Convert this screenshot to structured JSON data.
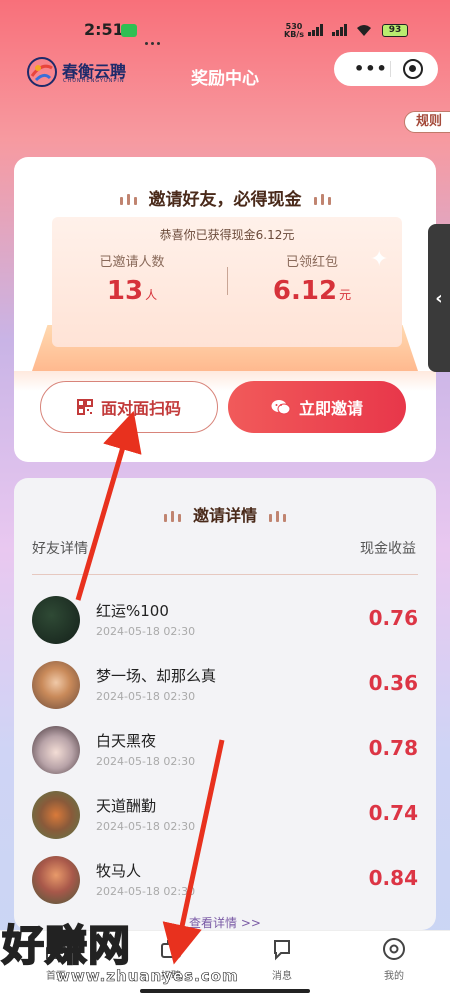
{
  "status_bar": {
    "time": "2:51",
    "net_speed_value": "530",
    "net_speed_unit": "KB/s",
    "signal_1": "HD",
    "signal_2": "HD",
    "battery": "93"
  },
  "header": {
    "logo_name": "春衡云聘",
    "logo_sub": "CHUNHENGYUNPIN",
    "title": "奖励中心",
    "more_label": "•••"
  },
  "rules_label": "规则",
  "invite": {
    "heading": "邀请好友，必得现金",
    "congrats": "恭喜你已获得现金6.12元",
    "invited_label": "已邀请人数",
    "invited_value": "13",
    "invited_unit": "人",
    "redpacket_label": "已领红包",
    "redpacket_value": "6.12",
    "redpacket_unit": "元",
    "scan_button": "面对面扫码",
    "invite_button": "立即邀请"
  },
  "details": {
    "heading": "邀请详情",
    "col_friends": "好友详情",
    "col_cash": "现金收益",
    "rows": [
      {
        "name": "红运%100",
        "time": "2024-05-18 02:30",
        "amount": "0.76"
      },
      {
        "name": "梦一场、却那么真",
        "time": "2024-05-18 02:30",
        "amount": "0.36"
      },
      {
        "name": "白天黑夜",
        "time": "2024-05-18 02:30",
        "amount": "0.78"
      },
      {
        "name": "天道酬勤",
        "time": "2024-05-18 02:30",
        "amount": "0.74"
      },
      {
        "name": "牧马人",
        "time": "2024-05-18 02:30",
        "amount": "0.84"
      }
    ],
    "see_more": "查看详情 >>"
  },
  "tabs": [
    {
      "label": "首页",
      "icon": "home-icon"
    },
    {
      "label": "招聘",
      "icon": "briefcase-icon"
    },
    {
      "label": "消息",
      "icon": "message-icon"
    },
    {
      "label": "我的",
      "icon": "profile-icon"
    }
  ],
  "watermark": {
    "text": "好赚网",
    "url": "www.zhuanyes.com"
  },
  "colors": {
    "accent_red": "#dc3545",
    "brand_navy": "#1e2a6a",
    "annotation_arrow": "#e8311e"
  }
}
